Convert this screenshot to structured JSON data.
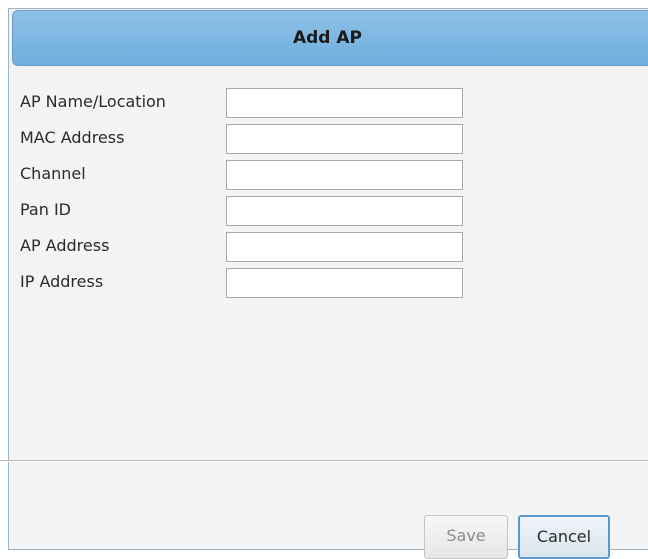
{
  "dialog": {
    "title": "Add AP"
  },
  "form": {
    "fields": [
      {
        "label": "AP Name/Location",
        "value": ""
      },
      {
        "label": "MAC Address",
        "value": ""
      },
      {
        "label": "Channel",
        "value": ""
      },
      {
        "label": "Pan ID",
        "value": ""
      },
      {
        "label": "AP Address",
        "value": ""
      },
      {
        "label": "IP Address",
        "value": ""
      }
    ]
  },
  "buttons": {
    "save_label": "Save",
    "cancel_label": "Cancel"
  },
  "colors": {
    "titlebar": "#7bb6e0",
    "cancel_border": "#5b9bd1"
  }
}
